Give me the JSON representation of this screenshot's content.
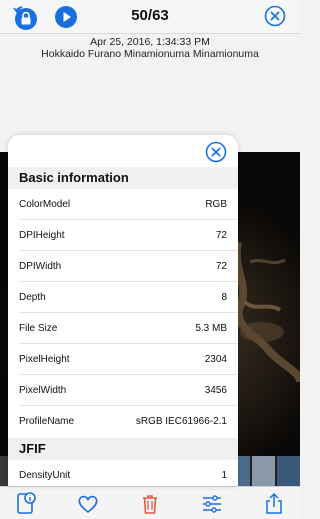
{
  "header": {
    "counter": "50/63",
    "date": "Apr 25, 2016, 1:34:33 PM",
    "location": "Hokkaido Furano Minamionuma Minamionuma"
  },
  "icons": {
    "top_left": "lock-rotation-icon",
    "play": "play-icon",
    "close": "close-icon",
    "info": "info-icon",
    "heart": "heart-icon",
    "trash": "trash-icon",
    "adjust": "sliders-icon",
    "share": "share-icon"
  },
  "colors": {
    "accent": "#1a6fe0",
    "trash": "#e05a4a"
  },
  "sheet": {
    "sections": [
      {
        "title": "Basic information",
        "rows": [
          {
            "key": "ColorModel",
            "value": "RGB"
          },
          {
            "key": "DPIHeight",
            "value": "72"
          },
          {
            "key": "DPIWidth",
            "value": "72"
          },
          {
            "key": "Depth",
            "value": "8"
          },
          {
            "key": "File Size",
            "value": "5.3 MB"
          },
          {
            "key": "PixelHeight",
            "value": "2304"
          },
          {
            "key": "PixelWidth",
            "value": "3456"
          },
          {
            "key": "ProfileName",
            "value": "sRGB IEC61966-2.1"
          }
        ]
      },
      {
        "title": "JFIF",
        "rows": [
          {
            "key": "DensityUnit",
            "value": "1"
          }
        ]
      }
    ]
  }
}
